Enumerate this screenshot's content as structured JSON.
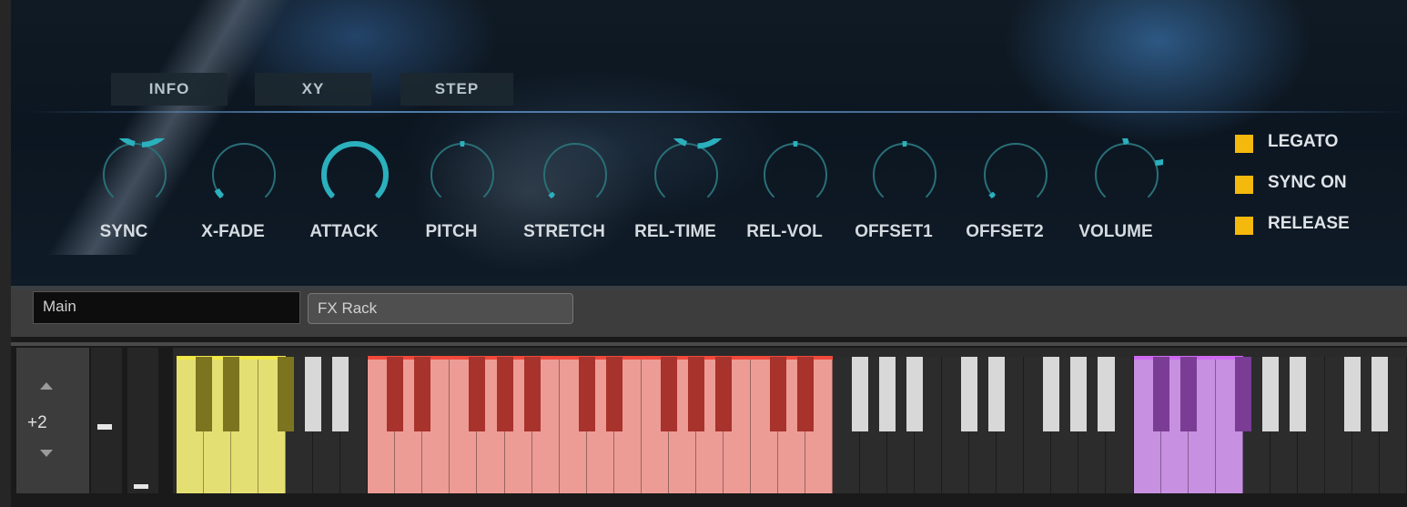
{
  "tabs": [
    "INFO",
    "XY",
    "STEP"
  ],
  "knobs": [
    {
      "label": "SYNC",
      "value": 0.55
    },
    {
      "label": "X-FADE",
      "value": 0.06
    },
    {
      "label": "ATTACK",
      "value": 1.0
    },
    {
      "label": "PITCH",
      "value": 0.5
    },
    {
      "label": "STRETCH",
      "value": 0.02
    },
    {
      "label": "REL-TIME",
      "value": 0.58
    },
    {
      "label": "REL-VOL",
      "value": 0.5
    },
    {
      "label": "OFFSET1",
      "value": 0.5
    },
    {
      "label": "OFFSET2",
      "value": 0.0
    },
    {
      "label": "VOLUME",
      "value": 0.75
    }
  ],
  "toggles": [
    {
      "label": "LEGATO",
      "on": true
    },
    {
      "label": "SYNC ON",
      "on": true
    },
    {
      "label": "RELEASE",
      "on": true
    }
  ],
  "panel_tabs": {
    "main": "Main",
    "fx_rack": "FX Rack"
  },
  "octave_shift": "+2",
  "colors": {
    "knob_arc": "#2bb0bd",
    "knob_track": "#2a6f77",
    "toggle": "#f5b80c",
    "zone_yellow": "#e4df73",
    "zone_red": "#ec9c95",
    "zone_purple": "#c890e0",
    "key_white": "#d8d8d8"
  },
  "keyboard": {
    "zones": [
      {
        "name": "yellow",
        "first_white": 0,
        "last_white": 3
      },
      {
        "name": "red",
        "first_white": 7,
        "last_white": 23
      },
      {
        "name": "purple",
        "first_white": 35,
        "last_white": 38
      }
    ],
    "white_keys": 45
  }
}
